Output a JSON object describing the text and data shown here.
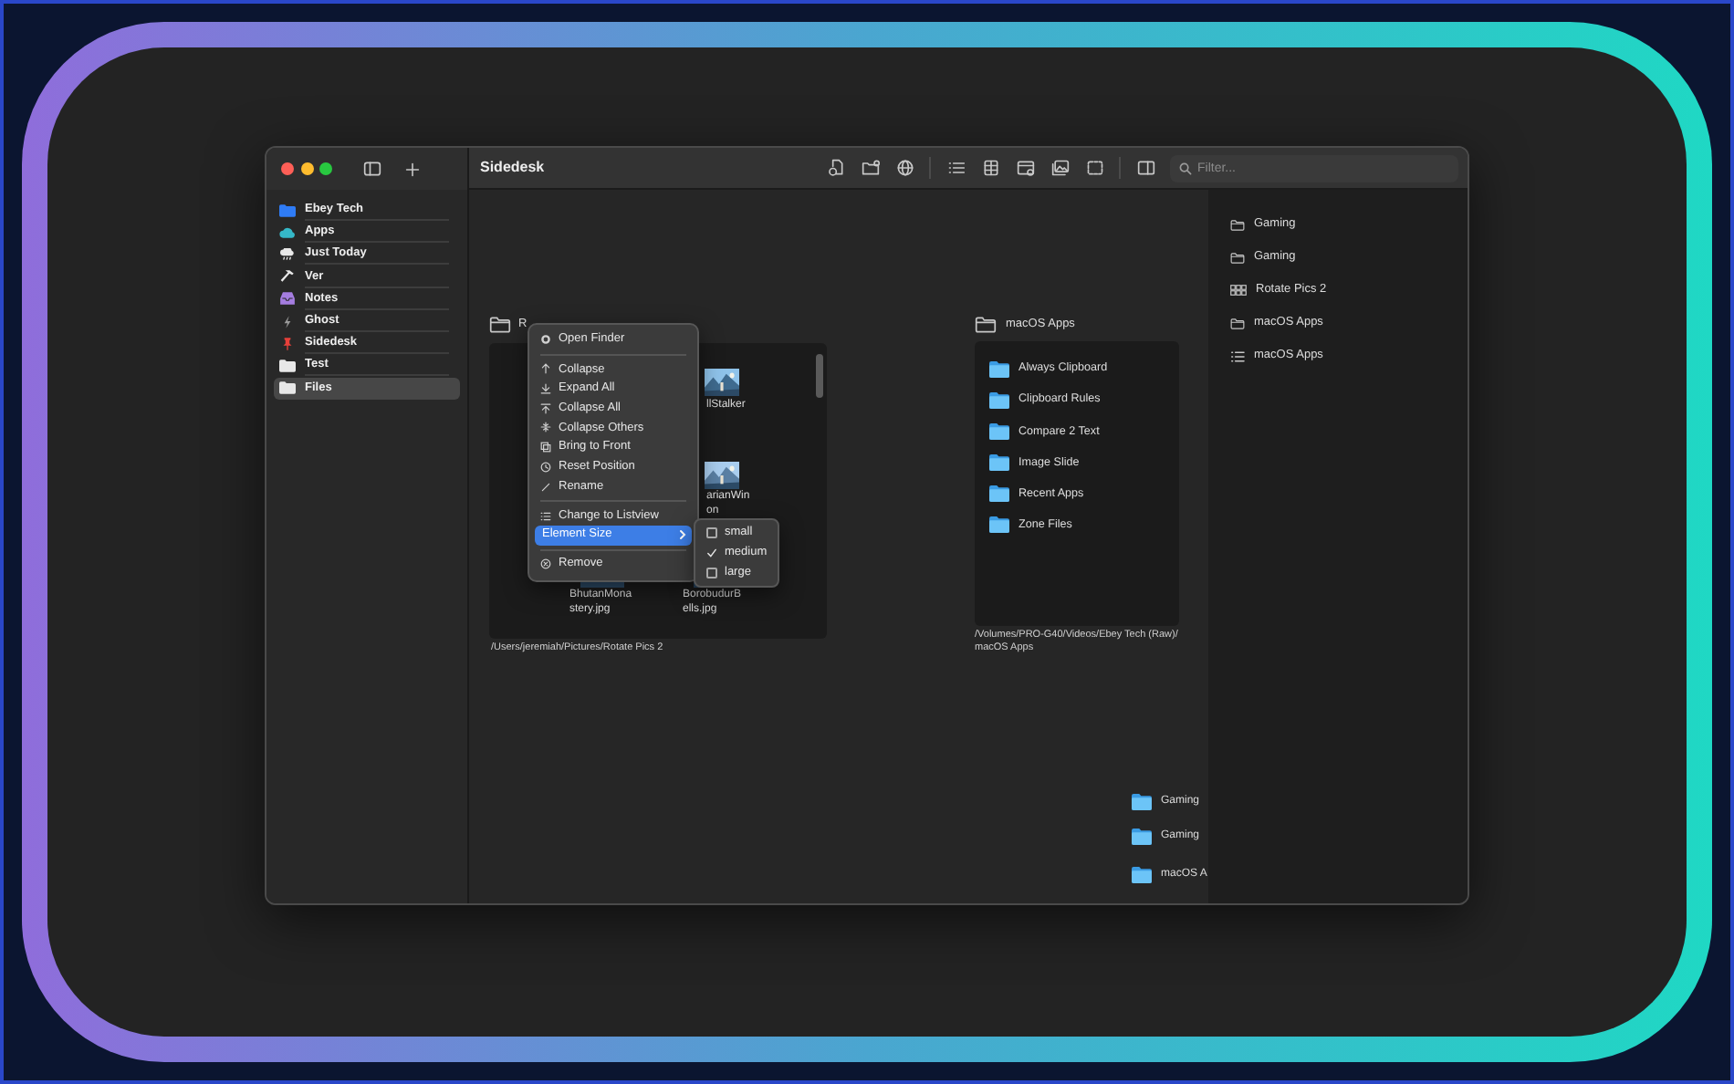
{
  "window": {
    "title": "Sidedesk"
  },
  "sidebar": {
    "items": [
      {
        "label": "Ebey Tech",
        "color": "#2f7cf6",
        "selected": false
      },
      {
        "label": "Apps",
        "color": "#35b8c8",
        "selected": false
      },
      {
        "label": "Just Today",
        "color": "#e8e8e8",
        "selected": false
      },
      {
        "label": "Ver",
        "color": "#e8e8e8",
        "selected": false
      },
      {
        "label": "Notes",
        "color": "#a57de0",
        "selected": false
      },
      {
        "label": "Ghost",
        "color": "#9a9a9a",
        "selected": false
      },
      {
        "label": "Sidedesk",
        "color": "#e8403a",
        "selected": false
      },
      {
        "label": "Test",
        "color": "#e8e8e8",
        "selected": false
      },
      {
        "label": "Files",
        "color": "#e8e8e8",
        "selected": true
      }
    ]
  },
  "search": {
    "placeholder": "Filter..."
  },
  "canvas": {
    "gallery_panel": {
      "title": "R",
      "thumbnails": [
        {
          "lines": [
            "llStalker"
          ]
        },
        {
          "lines": [
            "arianWin",
            "on"
          ]
        },
        {
          "lines": [
            "BhutanMona",
            "stery.jpg"
          ]
        },
        {
          "lines": [
            "BorobudurB",
            "ells.jpg"
          ]
        }
      ],
      "path": "/Users/jeremiah/Pictures/Rotate Pics 2"
    },
    "folder_panel": {
      "title": "macOS Apps",
      "folders": [
        "Always Clipboard",
        "Clipboard Rules",
        "Compare 2 Text",
        "Image Slide",
        "Recent Apps",
        "Zone Files"
      ],
      "path_lines": [
        "/Volumes/PRO-G40/Videos/Ebey Tech (Raw)/",
        "macOS Apps"
      ]
    },
    "loose_folders": [
      "Gaming",
      "Gaming",
      "macOS A"
    ]
  },
  "context_menu": {
    "groups": [
      [
        {
          "label": "Open Finder",
          "selected": false,
          "has_submenu": false
        }
      ],
      [
        {
          "label": "Collapse",
          "selected": false,
          "has_submenu": false
        },
        {
          "label": "Expand All",
          "selected": false,
          "has_submenu": false
        },
        {
          "label": "Collapse All",
          "selected": false,
          "has_submenu": false
        },
        {
          "label": "Collapse Others",
          "selected": false,
          "has_submenu": false
        },
        {
          "label": "Bring to Front",
          "selected": false,
          "has_submenu": false
        },
        {
          "label": "Reset Position",
          "selected": false,
          "has_submenu": false
        },
        {
          "label": "Rename",
          "selected": false,
          "has_submenu": false
        }
      ],
      [
        {
          "label": "Change to Listview",
          "selected": false,
          "has_submenu": false
        },
        {
          "label": "Element Size",
          "selected": true,
          "has_submenu": true
        }
      ],
      [
        {
          "label": "Remove",
          "selected": false,
          "has_submenu": false
        }
      ]
    ]
  },
  "submenu": {
    "items": [
      {
        "label": "small",
        "checked": false
      },
      {
        "label": "medium",
        "checked": true
      },
      {
        "label": "large",
        "checked": false
      }
    ]
  },
  "recent": {
    "items": [
      {
        "kind": "folder",
        "label": "Gaming"
      },
      {
        "kind": "folder",
        "label": "Gaming"
      },
      {
        "kind": "gallery",
        "label": "Rotate Pics 2"
      },
      {
        "kind": "folder",
        "label": "macOS Apps"
      },
      {
        "kind": "list",
        "label": "macOS Apps"
      }
    ]
  }
}
